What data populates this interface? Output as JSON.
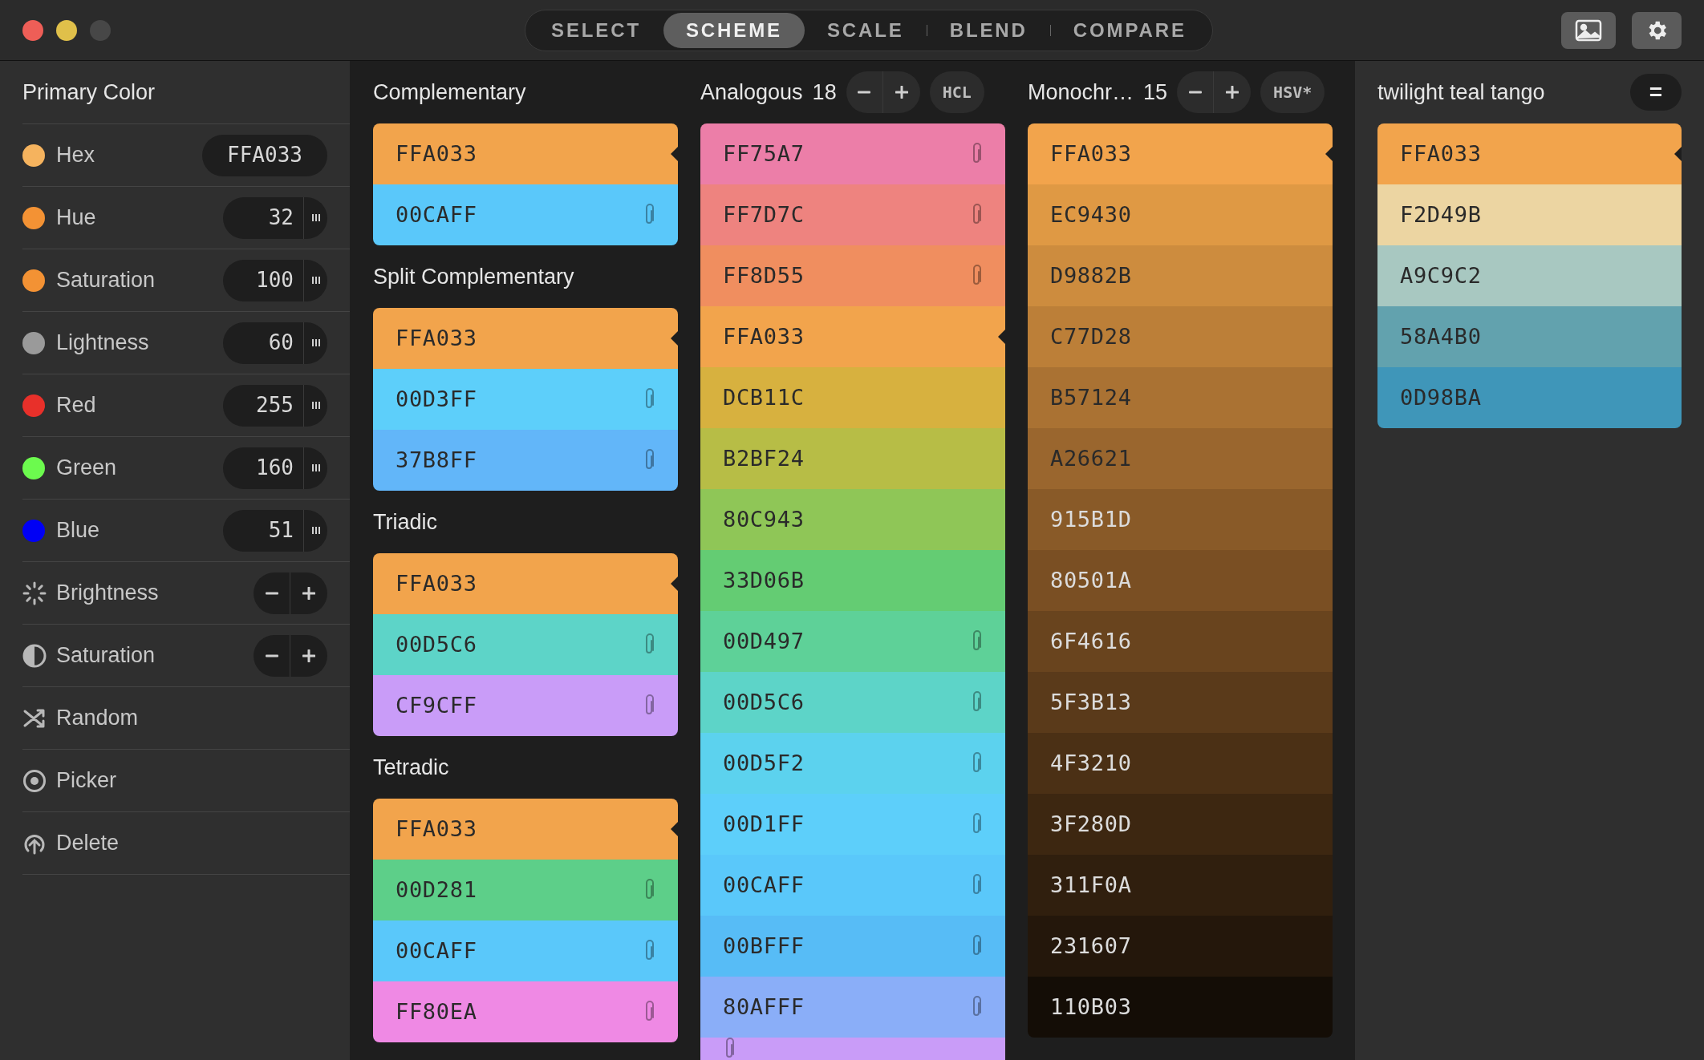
{
  "tabs": [
    {
      "label": "SELECT",
      "selected": false
    },
    {
      "label": "SCHEME",
      "selected": true
    },
    {
      "label": "SCALE",
      "selected": false
    },
    {
      "label": "BLEND",
      "selected": false
    },
    {
      "label": "COMPARE",
      "selected": false
    }
  ],
  "sidebar": {
    "title": "Primary Color",
    "rows": [
      {
        "kind": "hex",
        "label": "Hex",
        "color": "#f5b35e",
        "value": "FFA033"
      },
      {
        "kind": "number",
        "label": "Hue",
        "color": "#f39234",
        "value": "32"
      },
      {
        "kind": "number",
        "label": "Saturation",
        "color": "#f39234",
        "value": "100"
      },
      {
        "kind": "number",
        "label": "Lightness",
        "color": "#9a9a9a",
        "value": "60"
      },
      {
        "kind": "number",
        "label": "Red",
        "color": "#e8302a",
        "value": "255"
      },
      {
        "kind": "number",
        "label": "Green",
        "color": "#6cfa4e",
        "value": "160"
      },
      {
        "kind": "number",
        "label": "Blue",
        "color": "#0000f5",
        "value": "51"
      },
      {
        "kind": "stepper",
        "label": "Brightness"
      },
      {
        "kind": "stepper",
        "label": "Saturation"
      },
      {
        "kind": "action",
        "label": "Random"
      },
      {
        "kind": "action",
        "label": "Picker"
      },
      {
        "kind": "action",
        "label": "Delete"
      }
    ]
  },
  "schemes": [
    {
      "title": "Complementary",
      "swatches": [
        {
          "hex": "FFA033",
          "color": "#f2a44c",
          "current": true,
          "pinned": false
        },
        {
          "hex": "00CAFF",
          "color": "#5ac8fa",
          "current": false,
          "pinned": true
        }
      ]
    },
    {
      "title": "Split Complementary",
      "swatches": [
        {
          "hex": "FFA033",
          "color": "#f2a44c",
          "current": true,
          "pinned": false
        },
        {
          "hex": "00D3FF",
          "color": "#5dcffa",
          "current": false,
          "pinned": true
        },
        {
          "hex": "37B8FF",
          "color": "#62b6f9",
          "current": false,
          "pinned": true
        }
      ]
    },
    {
      "title": "Triadic",
      "swatches": [
        {
          "hex": "FFA033",
          "color": "#f2a44c",
          "current": true,
          "pinned": false
        },
        {
          "hex": "00D5C6",
          "color": "#5dd4c8",
          "current": false,
          "pinned": true
        },
        {
          "hex": "CF9CFF",
          "color": "#c99cf8",
          "current": false,
          "pinned": true
        }
      ]
    },
    {
      "title": "Tetradic",
      "swatches": [
        {
          "hex": "FFA033",
          "color": "#f2a44c",
          "current": true,
          "pinned": false
        },
        {
          "hex": "00D281",
          "color": "#5dcf89",
          "current": false,
          "pinned": true
        },
        {
          "hex": "00CAFF",
          "color": "#5ac8fa",
          "current": false,
          "pinned": true
        },
        {
          "hex": "FF80EA",
          "color": "#ef89e4",
          "current": false,
          "pinned": true
        }
      ]
    }
  ],
  "analogous": {
    "title": "Analogous",
    "count": "18",
    "mode": "HCL",
    "swatches": [
      {
        "hex": "FF75A7",
        "color": "#ec7ea8",
        "current": false,
        "pinned": true
      },
      {
        "hex": "FF7D7C",
        "color": "#ee837f",
        "current": false,
        "pinned": true
      },
      {
        "hex": "FF8D55",
        "color": "#f08e5f",
        "current": false,
        "pinned": true
      },
      {
        "hex": "FFA033",
        "color": "#f2a44c",
        "current": true,
        "pinned": false
      },
      {
        "hex": "DCB11C",
        "color": "#d7b13f",
        "current": false,
        "pinned": false
      },
      {
        "hex": "B2BF24",
        "color": "#b7bd46",
        "current": false,
        "pinned": false
      },
      {
        "hex": "80C943",
        "color": "#8fc657",
        "current": false,
        "pinned": false
      },
      {
        "hex": "33D06B",
        "color": "#64cc73",
        "current": false,
        "pinned": false
      },
      {
        "hex": "00D497",
        "color": "#5ed198",
        "current": false,
        "pinned": true
      },
      {
        "hex": "00D5C6",
        "color": "#5dd4c8",
        "current": false,
        "pinned": true
      },
      {
        "hex": "00D5F2",
        "color": "#5cd2ee",
        "current": false,
        "pinned": true
      },
      {
        "hex": "00D1FF",
        "color": "#5dcffa",
        "current": false,
        "pinned": true
      },
      {
        "hex": "00CAFF",
        "color": "#5ac8fa",
        "current": false,
        "pinned": true
      },
      {
        "hex": "00BFFF",
        "color": "#57bcf6",
        "current": false,
        "pinned": true
      },
      {
        "hex": "80AFFF",
        "color": "#8aaef8",
        "current": false,
        "pinned": true
      },
      {
        "color": "#c99cf8",
        "current": false,
        "pinned": true
      }
    ]
  },
  "monochromatic": {
    "title": "Monochr…",
    "count": "15",
    "mode": "HSV*",
    "swatches": [
      {
        "hex": "FFA033",
        "color": "#f2a44c",
        "current": true
      },
      {
        "hex": "EC9430",
        "color": "#df9944",
        "current": false
      },
      {
        "hex": "D9882B",
        "color": "#cd8c3e",
        "current": false
      },
      {
        "hex": "C77D28",
        "color": "#bc7f38",
        "current": false
      },
      {
        "hex": "B57124",
        "color": "#aa7233",
        "current": false
      },
      {
        "hex": "A26621",
        "color": "#9a662e",
        "current": false
      },
      {
        "hex": "915B1D",
        "color": "#895a28",
        "current": false
      },
      {
        "hex": "80501A",
        "color": "#7a4f23",
        "current": false
      },
      {
        "hex": "6F4616",
        "color": "#69441e",
        "current": false
      },
      {
        "hex": "5F3B13",
        "color": "#5a3a1a",
        "current": false
      },
      {
        "hex": "4F3210",
        "color": "#4b3015",
        "current": false
      },
      {
        "hex": "3F280D",
        "color": "#3d2711",
        "current": false
      },
      {
        "hex": "311F0A",
        "color": "#301f0e",
        "current": false
      },
      {
        "hex": "231607",
        "color": "#24170b",
        "current": false
      },
      {
        "hex": "110B03",
        "color": "#140d06",
        "current": false
      }
    ]
  },
  "palette": {
    "title": "twilight teal tango",
    "button": "=",
    "swatches": [
      {
        "hex": "FFA033",
        "color": "#f2a44c",
        "current": true
      },
      {
        "hex": "F2D49B",
        "color": "#ecd5a2",
        "current": false
      },
      {
        "hex": "A9C9C2",
        "color": "#a8c8c1",
        "current": false
      },
      {
        "hex": "58A4B0",
        "color": "#62a2ae",
        "current": false
      },
      {
        "hex": "0D98BA",
        "color": "#3f96b9",
        "current": false
      }
    ]
  }
}
